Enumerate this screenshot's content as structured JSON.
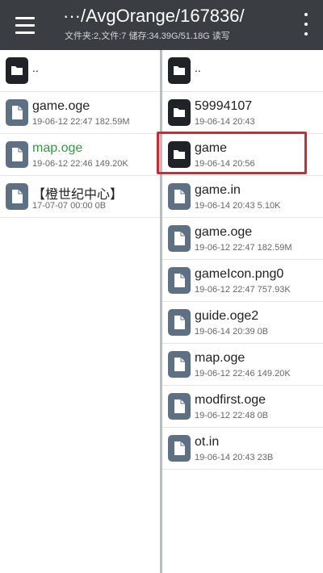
{
  "header": {
    "path": "···/AvgOrange/167836/",
    "status": "文件夹:2,文件:7  储存:34.39G/51.18G  读写"
  },
  "left_pane": {
    "up_label": "..",
    "items": [
      {
        "name": "game.oge",
        "meta": "19-06-12 22:47  182.59M",
        "type": "file",
        "icon": "file-icon"
      },
      {
        "name": "map.oge",
        "meta": "19-06-12 22:46  149.20K",
        "type": "file",
        "icon": "file-icon",
        "highlighted": true,
        "highlight_color": "#2e9e3c"
      },
      {
        "name": "【橙世纪中心】",
        "meta": "17-07-07 00:00  0B",
        "type": "file",
        "icon": "file-icon"
      }
    ]
  },
  "right_pane": {
    "up_label": "..",
    "items": [
      {
        "name": "59994107",
        "meta": "19-06-14 20:43",
        "type": "folder",
        "icon": "folder-icon"
      },
      {
        "name": "game",
        "meta": "19-06-14 20:56",
        "type": "folder",
        "icon": "folder-icon",
        "selected": true
      },
      {
        "name": "game.in",
        "meta": "19-06-14 20:43  5.10K",
        "type": "file",
        "icon": "file-icon"
      },
      {
        "name": "game.oge",
        "meta": "19-06-12 22:47  182.59M",
        "type": "file",
        "icon": "file-icon"
      },
      {
        "name": "gameIcon.png0",
        "meta": "19-06-12 22:47  757.93K",
        "type": "file",
        "icon": "file-icon"
      },
      {
        "name": "guide.oge2",
        "meta": "19-06-14 20:39  0B",
        "type": "file",
        "icon": "file-icon"
      },
      {
        "name": "map.oge",
        "meta": "19-06-12 22:46  149.20K",
        "type": "file",
        "icon": "file-icon"
      },
      {
        "name": "modfirst.oge",
        "meta": "19-06-12 22:48  0B",
        "type": "file",
        "icon": "file-icon"
      },
      {
        "name": "ot.in",
        "meta": "19-06-14 20:43  23B",
        "type": "file",
        "icon": "file-icon"
      }
    ]
  },
  "colors": {
    "header_bg": "#3a3d42",
    "selection_outline": "#d8262e",
    "folder_icon": "#1f2226",
    "file_icon": "#5e7184"
  }
}
